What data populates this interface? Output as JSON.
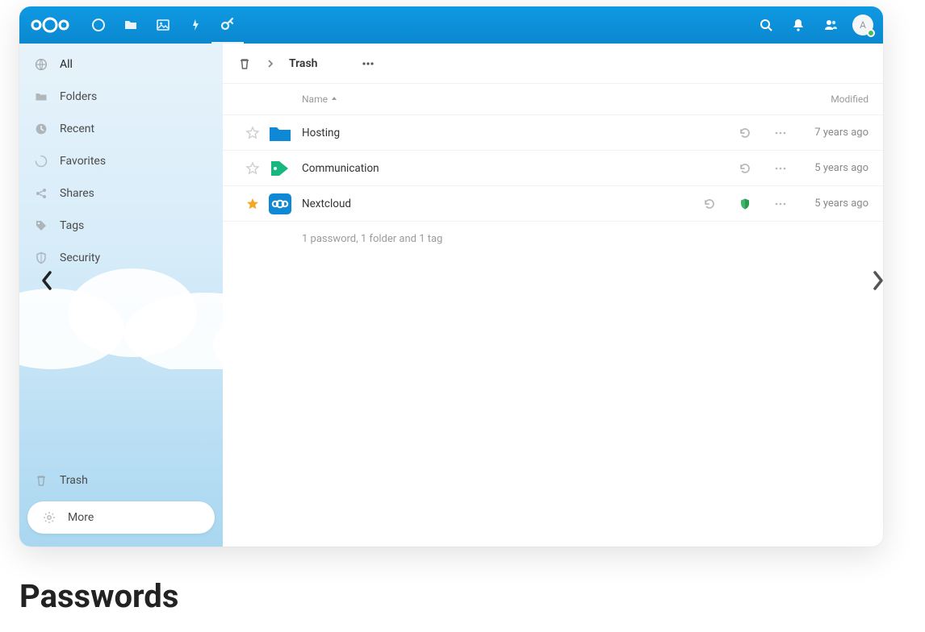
{
  "page_heading": "Passwords",
  "topbar": {
    "avatar_initial": "A"
  },
  "sidebar": {
    "items": [
      {
        "label": "All"
      },
      {
        "label": "Folders"
      },
      {
        "label": "Recent"
      },
      {
        "label": "Favorites"
      },
      {
        "label": "Shares"
      },
      {
        "label": "Tags"
      },
      {
        "label": "Security"
      }
    ],
    "trash_label": "Trash",
    "more_label": "More"
  },
  "breadcrumb": {
    "title": "Trash"
  },
  "columns": {
    "name": "Name",
    "modified": "Modified"
  },
  "rows": [
    {
      "name": "Hosting",
      "modified": "7 years ago",
      "type": "folder",
      "favorite": false,
      "shield": false
    },
    {
      "name": "Communication",
      "modified": "5 years ago",
      "type": "tag",
      "favorite": false,
      "shield": false
    },
    {
      "name": "Nextcloud",
      "modified": "5 years ago",
      "type": "password",
      "favorite": true,
      "shield": true
    }
  ],
  "summary": "1 password, 1 folder and 1 tag"
}
